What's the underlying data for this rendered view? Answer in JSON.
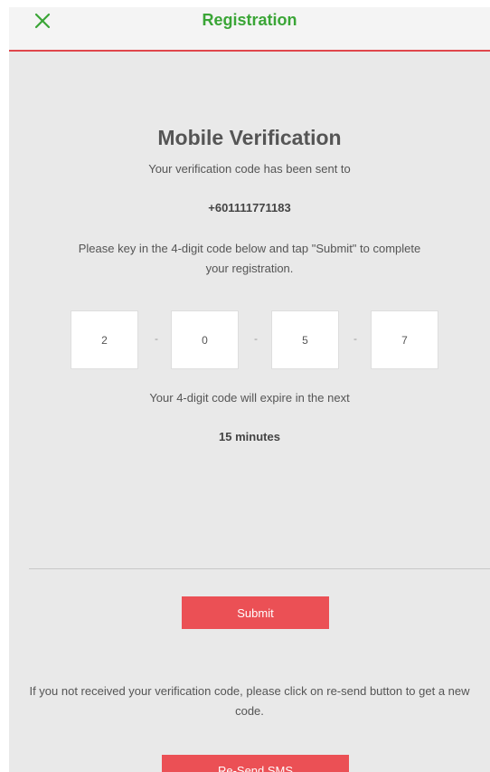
{
  "header": {
    "close_icon": "close-icon",
    "title": "Registration",
    "accent_color": "#3aa536",
    "border_color": "#e0474c"
  },
  "main": {
    "title": "Mobile Verification",
    "sent_text": "Your verification code has been sent to",
    "phone": "+601111771183",
    "instructions": "Please key in the 4-digit code below and tap \"Submit\" to complete your registration.",
    "code_digits": [
      "2",
      "0",
      "5",
      "7"
    ],
    "separator": "-",
    "expire_text": "Your 4-digit code will expire in the next",
    "expire_value": "15 minutes"
  },
  "actions": {
    "submit_label": "Submit",
    "resend_info": "If you not received your verification code, please click on re-send button to get a new code.",
    "resend_label": "Re-Send SMS",
    "button_color": "#eb5055"
  }
}
